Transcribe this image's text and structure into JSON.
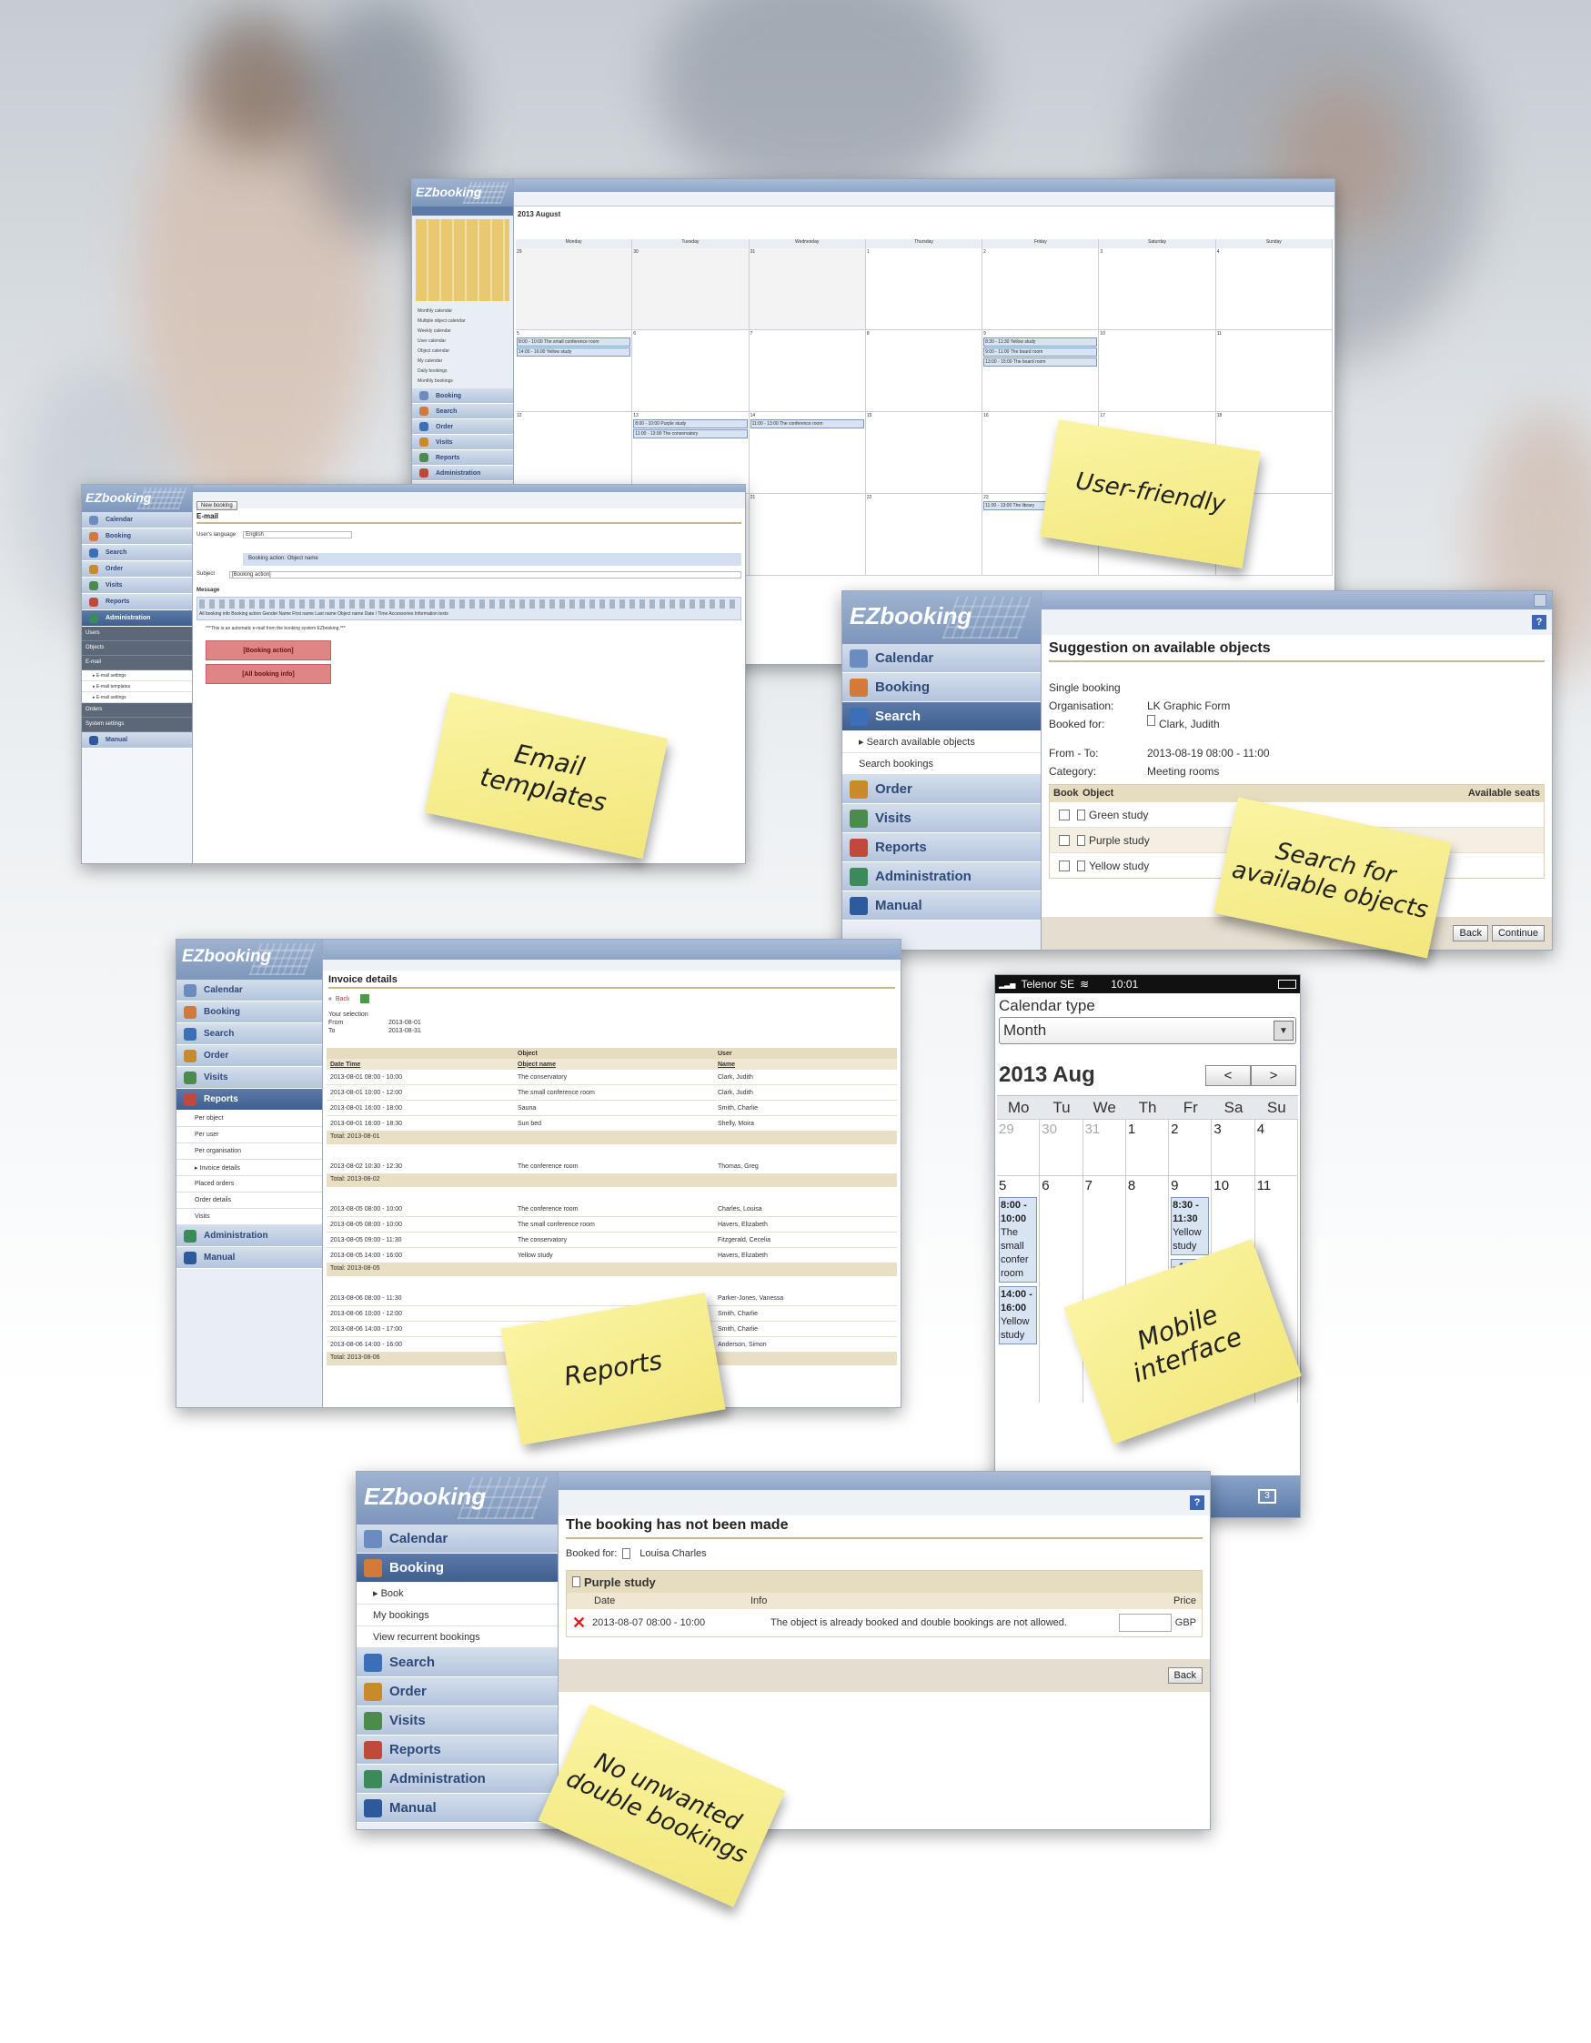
{
  "calendar_shot": {
    "logo": "EZbooking",
    "title": "2013 August",
    "weekdays": [
      "Monday",
      "Tuesday",
      "Wednesday",
      "Thursday",
      "Friday",
      "Saturday",
      "Sunday"
    ],
    "days": [
      "29",
      "30",
      "31",
      "1",
      "2",
      "3",
      "4",
      "5",
      "6",
      "7",
      "8",
      "9",
      "10",
      "11",
      "12",
      "13",
      "14",
      "15",
      "16",
      "17",
      "18",
      "19",
      "20",
      "21",
      "22",
      "23",
      "24",
      "25"
    ],
    "events": [
      {
        "day": "5",
        "text": "8:00 - 10:00 The small conference room"
      },
      {
        "day": "5",
        "text": "14:00 - 16:00 Yellow study"
      },
      {
        "day": "9",
        "text": "8:30 - 11:30 Yellow study"
      },
      {
        "day": "9",
        "text": "9:00 - 11:00 The board room"
      },
      {
        "day": "9",
        "text": "13:00 - 15:00 The board room"
      },
      {
        "day": "13",
        "text": "8:00 - 10:00 Purple study"
      },
      {
        "day": "13",
        "text": "11:00 - 13:00 The conservatory"
      },
      {
        "day": "14",
        "text": "11:00 - 13:00 The conference room"
      },
      {
        "day": "23",
        "text": "11:00 - 13:00 The library"
      }
    ],
    "side_items": [
      "Monthly calendar",
      "Multiple object calendar",
      "Weekly calendar",
      "User calendar",
      "Object calendar",
      "My calendar",
      "Daily bookings",
      "Monthly bookings"
    ],
    "nav": [
      "Booking",
      "Search",
      "Order",
      "Visits",
      "Reports",
      "Administration"
    ],
    "note": "User-friendly"
  },
  "email_shot": {
    "logo": "EZbooking",
    "nav": [
      "Calendar",
      "Booking",
      "Search",
      "Order",
      "Visits",
      "Reports",
      "Administration"
    ],
    "admin_subs": [
      "Users",
      "Objects",
      "E-mail",
      "Orders",
      "System settings"
    ],
    "email_subs": [
      "E-mail settings",
      "E-mail templates",
      "E-mail settings"
    ],
    "manual": "Manual",
    "heading": "E-mail",
    "lang_label": "User's language",
    "lang_value": "English",
    "action_label": "Booking action: Object name",
    "subject_label": "Subject",
    "subject_value": "[Booking action]",
    "message_label": "Message",
    "toolbar_tags": "All booking info  Booking action  Gender Name  First name  Last name  Object name  Date / Time  Accessories  Information texts",
    "auto_text": "***This is an automatic e-mail from the booking system EZbooking.***",
    "tag1": "[Booking action]",
    "tag2": "[All booking info]",
    "select_value": "New booking",
    "note": "Email templates"
  },
  "search_shot": {
    "logo": "EZbooking",
    "nav": [
      "Calendar",
      "Booking",
      "Search",
      "Order",
      "Visits",
      "Reports",
      "Administration",
      "Manual"
    ],
    "subs": [
      "Search available objects",
      "Search bookings"
    ],
    "heading": "Suggestion on available objects",
    "type": "Single booking",
    "org_label": "Organisation:",
    "org_value": "LK Graphic Form",
    "for_label": "Booked for:",
    "for_value": "Clark, Judith",
    "fromto_label": "From - To:",
    "fromto_value": "2013-08-19   08:00 - 11:00",
    "cat_label": "Category:",
    "cat_value": "Meeting rooms",
    "col_book": "Book",
    "col_object": "Object",
    "col_seats": "Available seats",
    "objects": [
      "Green study",
      "Purple study",
      "Yellow study"
    ],
    "back": "Back",
    "continue": "Continue",
    "note": "Search for available objects"
  },
  "reports_shot": {
    "logo": "EZbooking",
    "nav": [
      "Calendar",
      "Booking",
      "Search",
      "Order",
      "Visits",
      "Reports",
      "Administration",
      "Manual"
    ],
    "subs": [
      "Per object",
      "Per user",
      "Per organisation",
      "Invoice details",
      "Placed orders",
      "Order details",
      "Visits"
    ],
    "heading": "Invoice details",
    "back": "Back",
    "selection": "Your selection",
    "from_label": "From",
    "from_value": "2013-08-01",
    "to_label": "To",
    "to_value": "2013-08-31",
    "col_object": "Object",
    "col_user": "User",
    "col_datetime": "Date Time",
    "col_objname": "Object name",
    "col_name": "Name",
    "groups": [
      {
        "rows": [
          [
            "2013-08-01 08:00 - 10:00",
            "The conservatory",
            "Clark, Judith"
          ],
          [
            "2013-08-01 10:00 - 12:00",
            "The small conference room",
            "Clark, Judith"
          ],
          [
            "2013-08-01 16:00 - 18:00",
            "Sauna",
            "Smith, Charlie"
          ],
          [
            "2013-08-01 16:00 - 18:30",
            "Sun bed",
            "Shelly, Moira"
          ]
        ],
        "total": "Total: 2013-08-01"
      },
      {
        "rows": [
          [
            "2013-08-02 10:30 - 12:30",
            "The conference room",
            "Thomas, Greg"
          ]
        ],
        "total": "Total: 2013-08-02"
      },
      {
        "rows": [
          [
            "2013-08-05 08:00 - 10:00",
            "The conference room",
            "Charles, Louisa"
          ],
          [
            "2013-08-05 08:00 - 10:00",
            "The small conference room",
            "Havers, Elizabeth"
          ],
          [
            "2013-08-05 09:00 - 11:30",
            "The conservatory",
            "Fitzgerald, Cecelia"
          ],
          [
            "2013-08-05 14:00 - 16:00",
            "Yellow study",
            "Havers, Elizabeth"
          ]
        ],
        "total": "Total: 2013-08-05"
      },
      {
        "rows": [
          [
            "2013-08-06 08:00 - 11:30",
            "",
            "Parker-Jones, Vanessa"
          ],
          [
            "2013-08-06 10:00 - 12:00",
            "",
            "Smith, Charlie"
          ],
          [
            "2013-08-06 14:00 - 17:00",
            "",
            "Smith, Charlie"
          ],
          [
            "2013-08-06 14:00 - 16:00",
            "",
            "Anderson, Simon"
          ]
        ],
        "total": "Total: 2013-08-06"
      }
    ],
    "note": "Reports"
  },
  "mobile_shot": {
    "carrier": "Telenor SE",
    "time": "10:01",
    "cal_type_label": "Calendar type",
    "cal_type_value": "Month",
    "month": "2013 Aug",
    "prev": "<",
    "next": ">",
    "weekdays": [
      "Mo",
      "Tu",
      "We",
      "Th",
      "Fr",
      "Sa",
      "Su"
    ],
    "week1": [
      "29",
      "30",
      "31",
      "1",
      "2",
      "3",
      "4"
    ],
    "week2": [
      "5",
      "6",
      "7",
      "8",
      "9",
      "10",
      "11"
    ],
    "ev_mon": [
      "8:00 - 10:00",
      "The small confer room",
      "14:00 - 16:00",
      "Yellow study"
    ],
    "ev_fri": [
      "8:30 - 11:30",
      "Yellow study",
      "- 15:00",
      "The board"
    ],
    "badge": "3",
    "note": "Mobile interface"
  },
  "booking_shot": {
    "logo": "EZbooking",
    "nav": [
      "Calendar",
      "Booking",
      "Search",
      "Order",
      "Visits",
      "Reports",
      "Administration",
      "Manual"
    ],
    "subs": [
      "Book",
      "My bookings",
      "View recurrent bookings"
    ],
    "heading": "The booking has not been made",
    "for_label": "Booked for:",
    "for_value": "Louisa Charles",
    "object": "Purple study",
    "col_date": "Date",
    "col_info": "Info",
    "col_price": "Price",
    "row_date": "2013-08-07 08:00 - 10:00",
    "row_info": "The object is already booked and double bookings are not allowed.",
    "currency": "GBP",
    "back": "Back",
    "note": "No unwanted double bookings"
  },
  "colors": {
    "nav_active": "#3f5f90",
    "nav": "#b3c4dc",
    "note": "#f5eb85",
    "header_bar": "#8ea6c8",
    "error": "#d22222"
  }
}
